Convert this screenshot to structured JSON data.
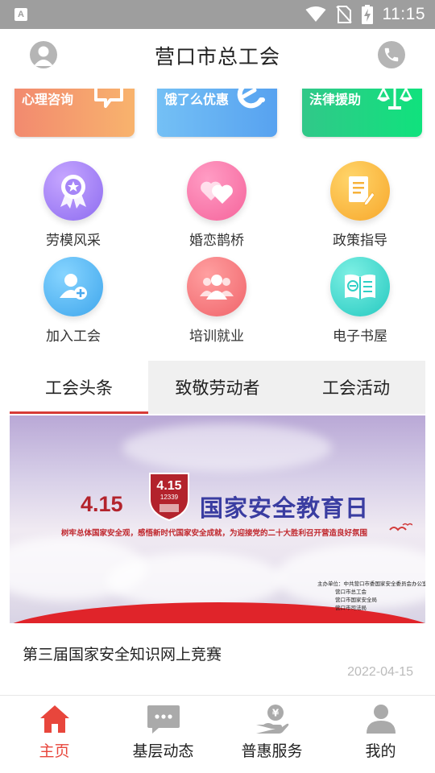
{
  "status_bar": {
    "time": "11:15",
    "notification_letter": "A"
  },
  "header": {
    "title": "营口市总工会"
  },
  "banner_cards": [
    {
      "label": "心理咨询"
    },
    {
      "label": "饿了么优惠"
    },
    {
      "label": "法律援助"
    }
  ],
  "grid_items": [
    {
      "label": "劳模风采",
      "icon": "medal-icon"
    },
    {
      "label": "婚恋鹊桥",
      "icon": "hearts-icon"
    },
    {
      "label": "政策指导",
      "icon": "document-icon"
    },
    {
      "label": "加入工会",
      "icon": "add-person-icon"
    },
    {
      "label": "培训就业",
      "icon": "people-icon"
    },
    {
      "label": "电子书屋",
      "icon": "ebook-icon"
    }
  ],
  "tabs": [
    {
      "label": "工会头条",
      "active": true
    },
    {
      "label": "致敬劳动者",
      "active": false
    },
    {
      "label": "工会活动",
      "active": false
    }
  ],
  "news": {
    "image": {
      "date_text": "4.15",
      "badge_number": "4.15",
      "badge_code": "12339",
      "headline": "国家安全教育日",
      "subline": "树牢总体国家安全观，感悟新时代国家安全成就，为迎接党的二十大胜利召开营造良好氛围",
      "organizers": [
        "主办单位：中共营口市委国家安全委员会办公室",
        "营口市总工会",
        "营口市国家安全局",
        "营口市司法局"
      ]
    },
    "title": "第三届国家安全知识网上竞赛",
    "date": "2022-04-15"
  },
  "bottom_nav": [
    {
      "label": "主页",
      "active": true
    },
    {
      "label": "基层动态",
      "active": false
    },
    {
      "label": "普惠服务",
      "active": false
    },
    {
      "label": "我的",
      "active": false
    }
  ],
  "colors": {
    "accent_red": "#e8463c",
    "status_bar": "#9e9e9e",
    "tab_bg": "#f0f0f0"
  }
}
